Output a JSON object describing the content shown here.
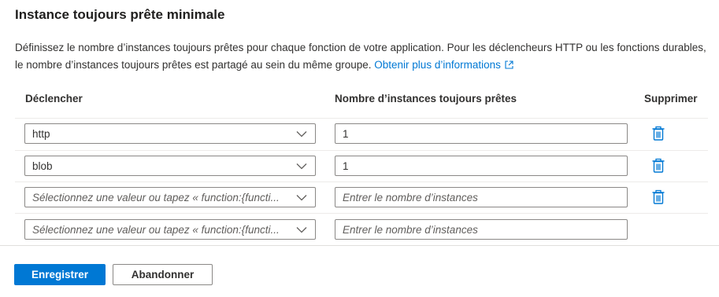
{
  "title": "Instance toujours prête minimale",
  "description": {
    "text": "Définissez le nombre d’instances toujours prêtes pour chaque fonction de votre application. Pour les déclencheurs HTTP ou les fonctions durables, le nombre d’instances toujours prêtes est partagé au sein du même groupe.",
    "link_label": "Obtenir plus d’informations",
    "link_icon": "external-link-icon"
  },
  "table": {
    "headers": {
      "trigger": "Déclencher",
      "count": "Nombre d’instances toujours prêtes",
      "delete": "Supprimer"
    },
    "rows": [
      {
        "trigger": "http",
        "count": "1"
      },
      {
        "trigger": "blob",
        "count": "1"
      },
      {
        "trigger_placeholder": "Sélectionnez une valeur ou tapez « function:{functi...",
        "count_placeholder": "Entrer le nombre d’instances"
      },
      {
        "trigger_placeholder": "Sélectionnez une valeur ou tapez « function:{functi...",
        "count_placeholder": "Entrer le nombre d’instances"
      }
    ]
  },
  "buttons": {
    "save": "Enregistrer",
    "discard": "Abandonner"
  },
  "colors": {
    "accent": "#0078d4",
    "border": "#8a8886",
    "divider": "#edebe9"
  }
}
